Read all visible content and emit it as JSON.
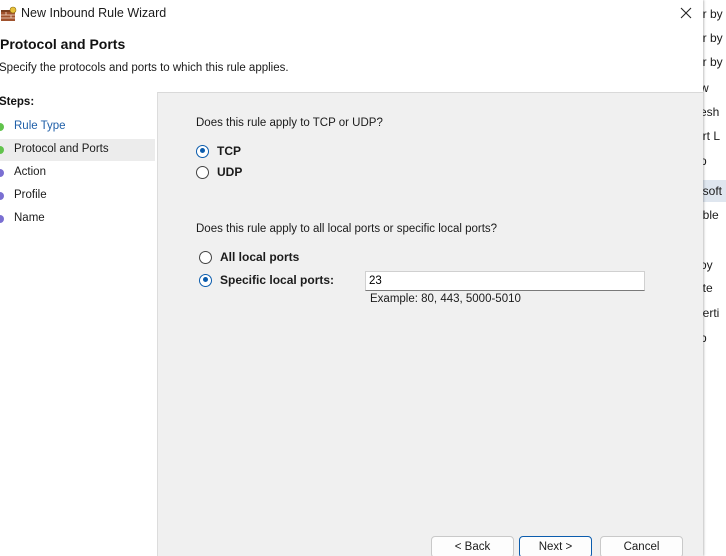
{
  "window": {
    "title": "New Inbound Rule Wizard"
  },
  "header": {
    "title": "Protocol and Ports",
    "subtitle": "Specify the protocols and ports to which this rule applies."
  },
  "steps": {
    "label": "Steps:",
    "items": [
      {
        "label": "Rule Type",
        "state": "done"
      },
      {
        "label": "Protocol and Ports",
        "state": "current"
      },
      {
        "label": "Action",
        "state": "todo"
      },
      {
        "label": "Profile",
        "state": "todo"
      },
      {
        "label": "Name",
        "state": "todo"
      }
    ]
  },
  "protocol": {
    "question": "Does this rule apply to TCP or UDP?",
    "options": [
      {
        "label": "TCP",
        "checked": true
      },
      {
        "label": "UDP",
        "checked": false
      }
    ]
  },
  "ports": {
    "question": "Does this rule apply to all local ports or specific local ports?",
    "all_label": "All local ports",
    "specific_label": "Specific local ports:",
    "selected": "specific",
    "value": "23",
    "example": "Example: 80, 443, 5000-5010"
  },
  "buttons": {
    "back": "< Back",
    "next": "Next >",
    "cancel": "Cancel"
  },
  "background_window": {
    "items": [
      "er by",
      "er by",
      "er by",
      "w",
      "resh",
      "ort L",
      "p",
      "osoft",
      "able",
      "oy",
      "ete",
      "perti",
      "p"
    ]
  },
  "colors": {
    "accent": "#0b5cad",
    "step_done": "#61c34c",
    "step_todo": "#7a6fd2",
    "link": "#1f5fa8"
  }
}
